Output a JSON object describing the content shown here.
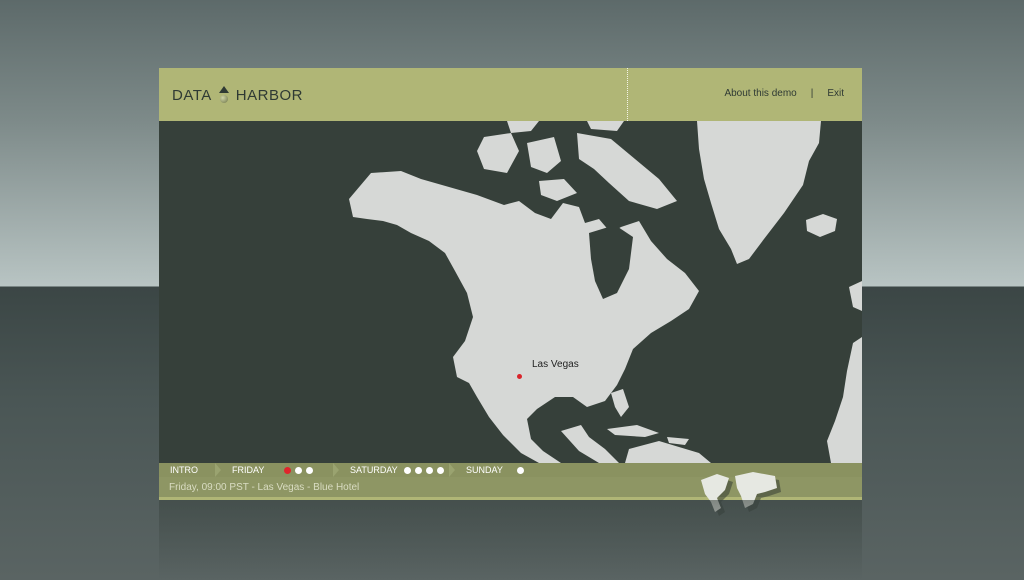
{
  "header": {
    "brand_left": "DATA",
    "brand_right": "HARBOR",
    "nav": {
      "about": "About this demo",
      "separator": "|",
      "exit": "Exit"
    }
  },
  "map": {
    "city_label": "Las Vegas"
  },
  "timeline": {
    "segments": [
      {
        "label": "INTRO",
        "dots": 0
      },
      {
        "label": "FRIDAY",
        "dots": 3,
        "active_dot": 1
      },
      {
        "label": "SATURDAY",
        "dots": 4
      },
      {
        "label": "SUNDAY",
        "dots": 1
      }
    ]
  },
  "status": {
    "text": "Friday, 09:00 PST - Las Vegas - Blue Hotel"
  },
  "colors": {
    "header_bg": "#b0b676",
    "map_bg": "#36403a",
    "land": "#d6d8d6",
    "active_dot": "#e0252c"
  }
}
